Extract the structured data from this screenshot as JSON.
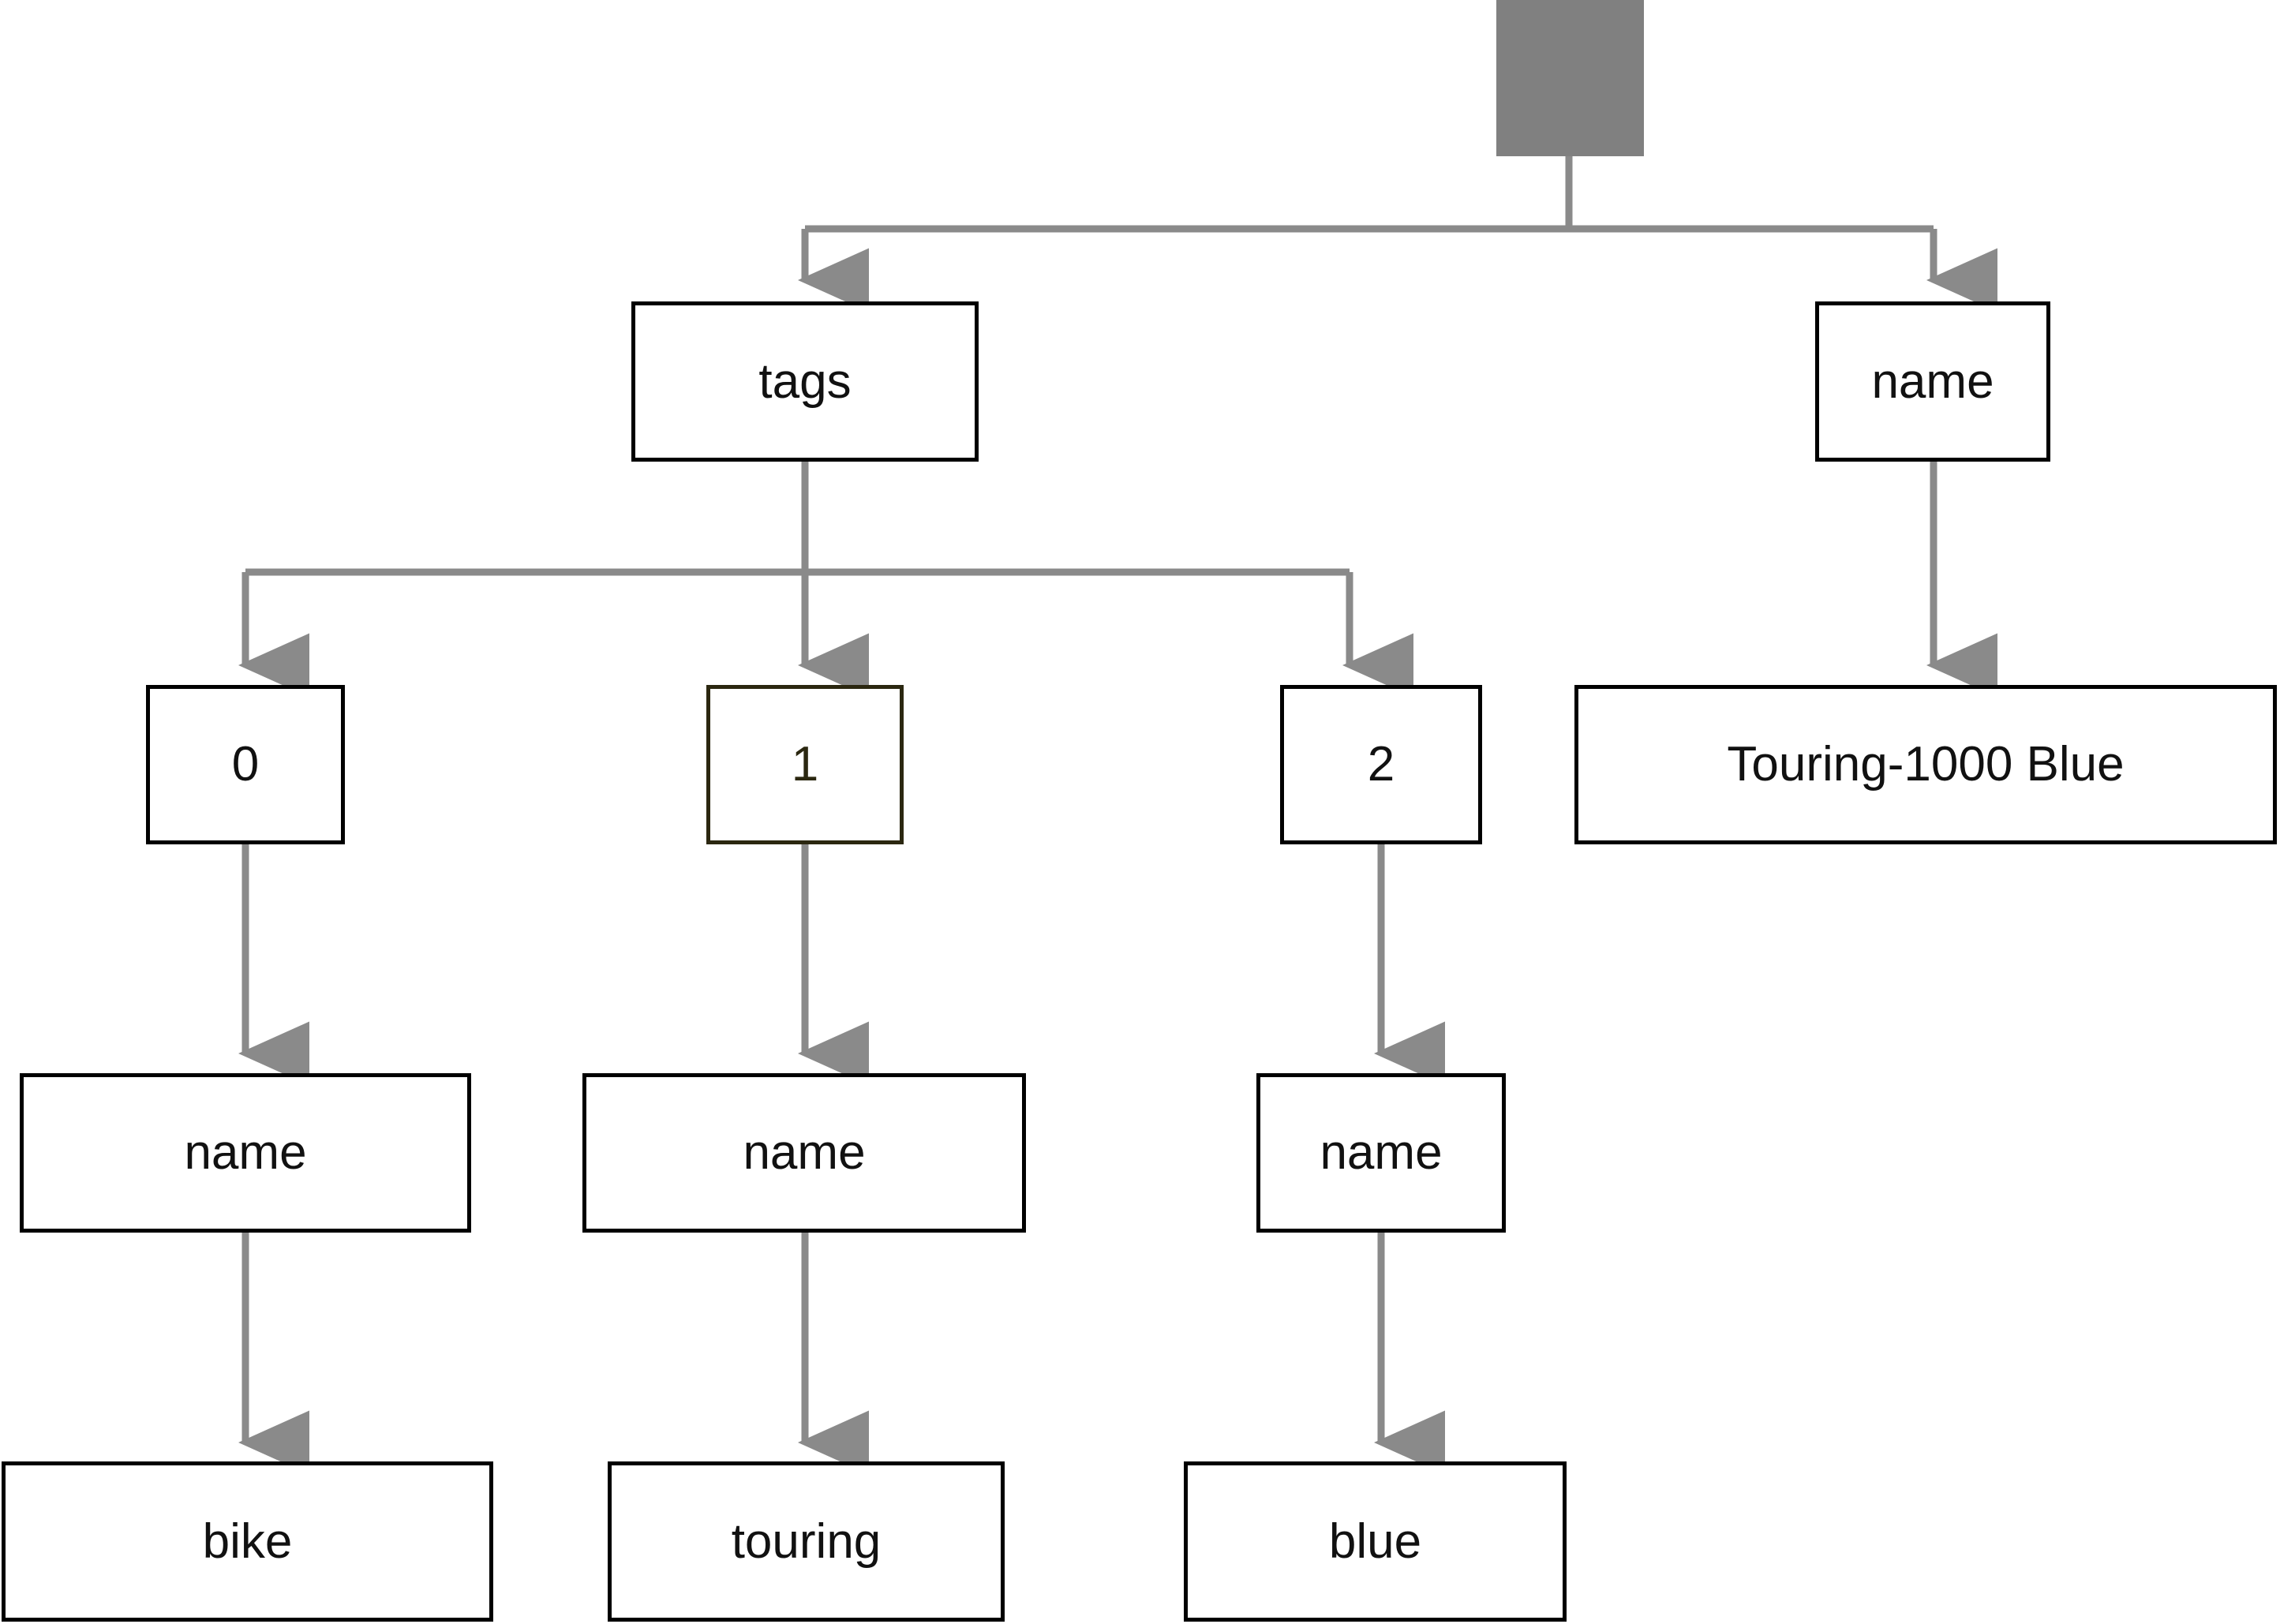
{
  "diagram": {
    "type": "tree",
    "title": "",
    "background_color": "#ffffff",
    "edge_color": "#8a8a8a",
    "node_border_color": "#000000",
    "highlight_border_color": "#2b2710",
    "root_fill_color": "#808080",
    "nodes": [
      {
        "id": "root",
        "label": "",
        "style": "root"
      },
      {
        "id": "tags",
        "label": "tags",
        "style": "normal"
      },
      {
        "id": "name_top",
        "label": "name",
        "style": "normal"
      },
      {
        "id": "idx0",
        "label": "0",
        "style": "normal"
      },
      {
        "id": "idx1",
        "label": "1",
        "style": "highlight"
      },
      {
        "id": "idx2",
        "label": "2",
        "style": "normal"
      },
      {
        "id": "product",
        "label": "Touring-1000 Blue",
        "style": "normal"
      },
      {
        "id": "name0",
        "label": "name",
        "style": "normal"
      },
      {
        "id": "name1",
        "label": "name",
        "style": "normal"
      },
      {
        "id": "name2",
        "label": "name",
        "style": "normal"
      },
      {
        "id": "bike",
        "label": "bike",
        "style": "normal"
      },
      {
        "id": "touring",
        "label": "touring",
        "style": "normal"
      },
      {
        "id": "blue",
        "label": "blue",
        "style": "normal"
      }
    ],
    "edges": [
      {
        "from": "root",
        "to": "tags"
      },
      {
        "from": "root",
        "to": "name_top"
      },
      {
        "from": "tags",
        "to": "idx0"
      },
      {
        "from": "tags",
        "to": "idx1"
      },
      {
        "from": "tags",
        "to": "idx2"
      },
      {
        "from": "name_top",
        "to": "product"
      },
      {
        "from": "idx0",
        "to": "name0"
      },
      {
        "from": "idx1",
        "to": "name1"
      },
      {
        "from": "idx2",
        "to": "name2"
      },
      {
        "from": "name0",
        "to": "bike"
      },
      {
        "from": "name1",
        "to": "touring"
      },
      {
        "from": "name2",
        "to": "blue"
      }
    ]
  }
}
